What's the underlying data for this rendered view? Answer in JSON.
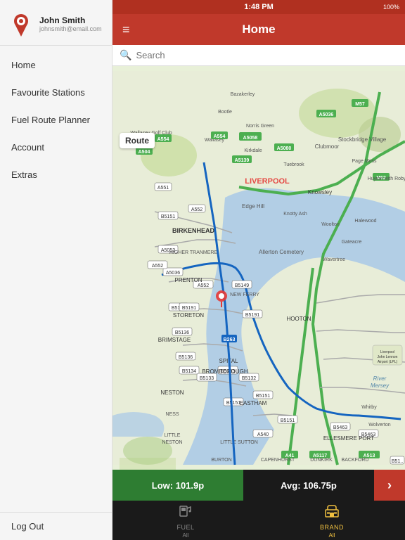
{
  "status_bar": {
    "time": "1:48 PM",
    "battery": "100%"
  },
  "topbar": {
    "title": "Home",
    "menu_icon": "≡"
  },
  "sidebar": {
    "user": {
      "name": "John Smith",
      "email": "johnsmith@email.com"
    },
    "nav_items": [
      {
        "label": "Home",
        "id": "home"
      },
      {
        "label": "Favourite Stations",
        "id": "favourite-stations"
      },
      {
        "label": "Fuel Route Planner",
        "id": "fuel-route-planner"
      },
      {
        "label": "Account",
        "id": "account"
      },
      {
        "label": "Extras",
        "id": "extras"
      }
    ],
    "logout_label": "Log Out"
  },
  "search": {
    "placeholder": "Search"
  },
  "map": {
    "route_label": "Route"
  },
  "price_bar": {
    "low_label": "Low: 101.9p",
    "avg_label": "Avg: 106.75p",
    "high_label": ""
  },
  "tab_bar": {
    "items": [
      {
        "label": "FUEL",
        "sublabel": "All",
        "icon": "⛽",
        "id": "fuel",
        "active": false
      },
      {
        "label": "BRAND",
        "sublabel": "All",
        "icon": "🏪",
        "id": "brand",
        "active": true
      }
    ]
  }
}
